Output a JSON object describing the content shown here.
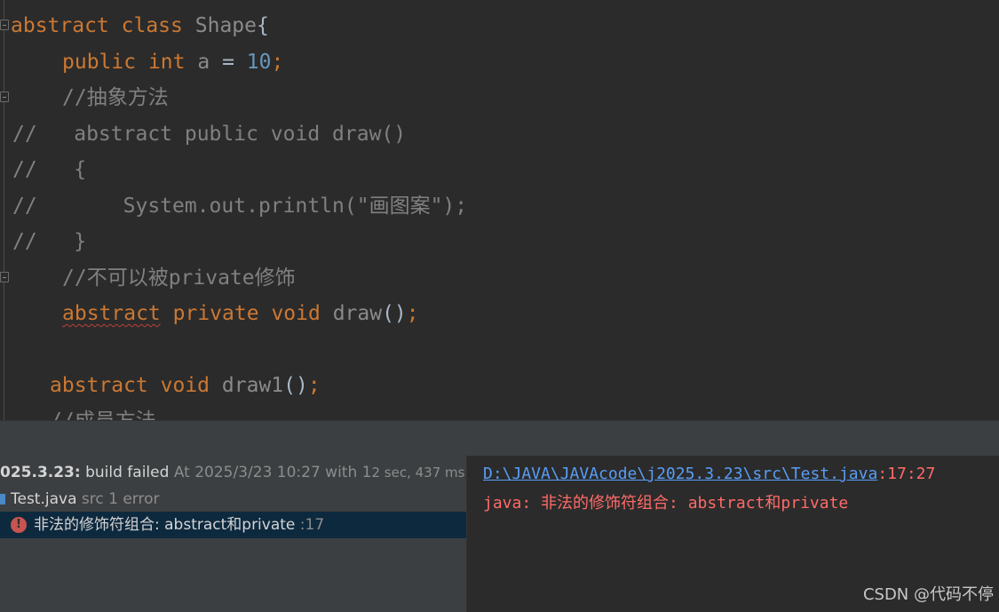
{
  "editor": {
    "lines": {
      "l1": {
        "kw1": "abstract",
        "kw2": "class",
        "name": "Shape",
        "brace": "{"
      },
      "l2": {
        "kw1": "public",
        "kw2": "int",
        "name": "a",
        "op": " = ",
        "num": "10",
        "semi": ";"
      },
      "l3": {
        "comment": "//抽象方法"
      },
      "l4": {
        "text": "//   abstract public void draw()"
      },
      "l5": {
        "text": "//   {"
      },
      "l6": {
        "text": "//       System.out.println(\"画图案\");"
      },
      "l7": {
        "text": "//   }"
      },
      "l8": {
        "comment_a": "//不可以被",
        "comment_b": "private",
        "comment_c": "修饰"
      },
      "l9": {
        "kw1": "abstract",
        "kw2": "private",
        "kw3": "void",
        "name": "draw",
        "parens": "()",
        "semi": ";"
      },
      "l10": {
        "kw1": "abstract",
        "kw2": "void",
        "name": "draw1",
        "parens": "()",
        "semi": ";"
      },
      "l11": {
        "comment": "//成员方法"
      }
    }
  },
  "build": {
    "header_bold": "025.3.23:",
    "header_status": "build failed",
    "header_time": "At 2025/3/23 10:27 with 1",
    "header_dur": "2 sec, 437 ms",
    "file_name": "Test.java",
    "file_meta": "src 1 error",
    "error_text": "非法的修饰符组合: abstract和private",
    "error_line": ":17"
  },
  "output": {
    "path": "D:\\JAVA\\JAVAcode\\j2025.3.23\\src\\Test.java",
    "location": ":17:27",
    "message": "java: 非法的修饰符组合: abstract和private"
  },
  "watermark": "CSDN @代码不停",
  "colors": {
    "editor_bg": "#2b2b2b",
    "keyword": "#cc7832",
    "number": "#6897bb",
    "comment": "#808080",
    "error": "#ff6b68",
    "link": "#589df6",
    "selection": "#0d293e"
  }
}
